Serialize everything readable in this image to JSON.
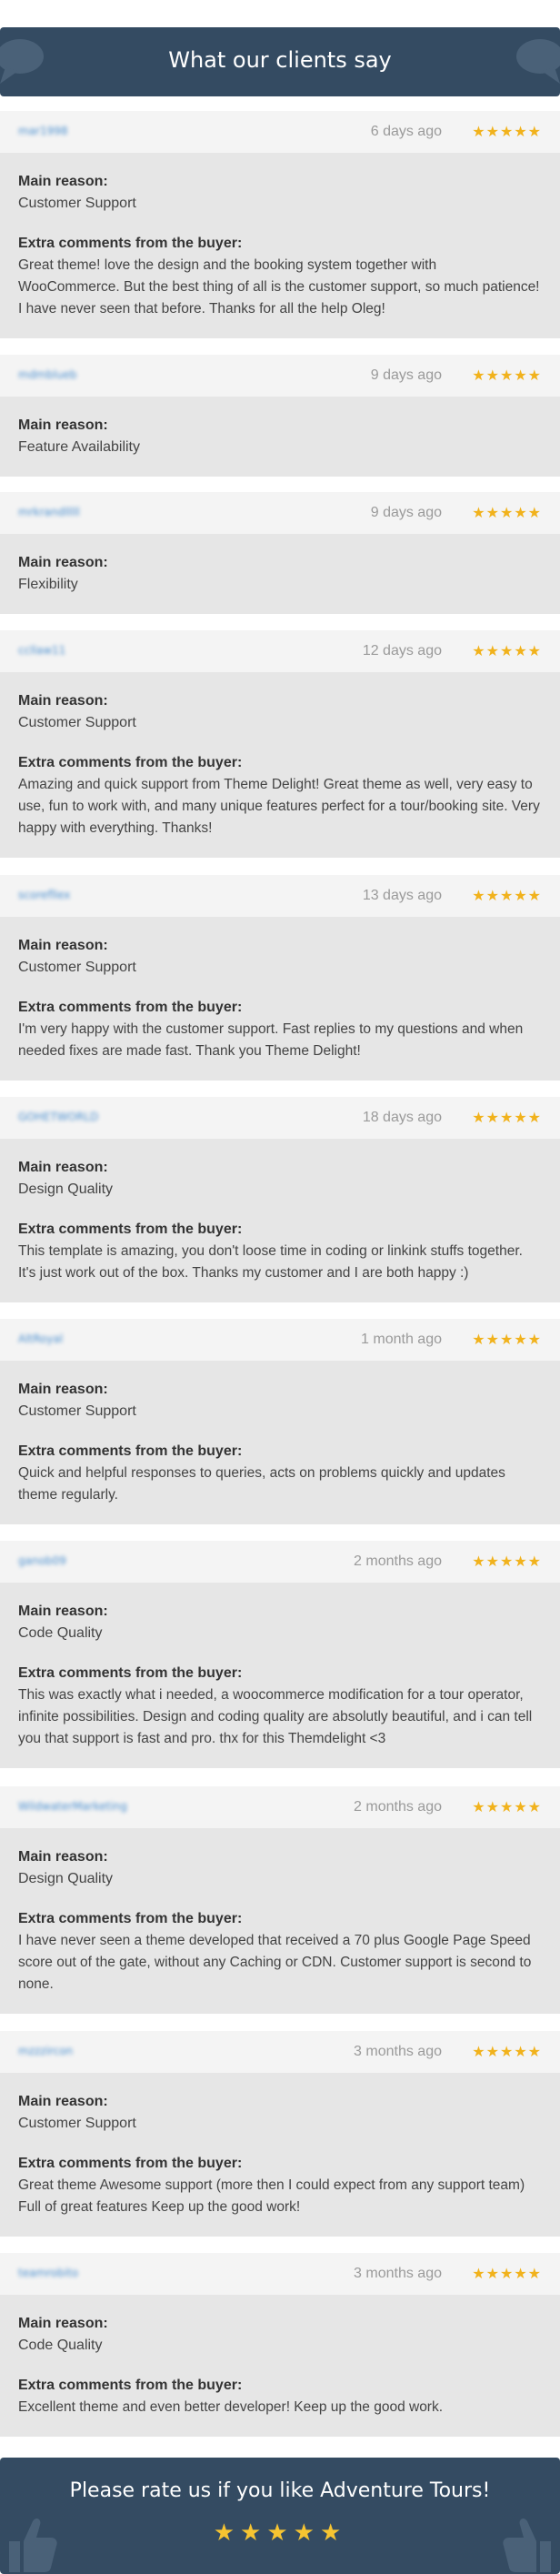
{
  "header": {
    "title": "What our clients say"
  },
  "labels": {
    "main_reason": "Main reason:",
    "extra_comments": "Extra comments from the buyer:"
  },
  "star_glyph": "★★★★★",
  "reviews": [
    {
      "username": "mar1998",
      "date": "6 days ago",
      "rating": 5,
      "main_reason": "Customer Support",
      "comment": "Great theme! love the design and the booking system together with WooCommerce. But the best thing of all is the customer support, so much patience! I have never seen that before. Thanks for all the help Oleg!"
    },
    {
      "username": "mdmblueb",
      "date": "9 days ago",
      "rating": 5,
      "main_reason": "Feature Availability",
      "comment": ""
    },
    {
      "username": "mrkrandlllll",
      "date": "9 days ago",
      "rating": 5,
      "main_reason": "Flexibility",
      "comment": ""
    },
    {
      "username": "ccllaw11",
      "date": "12 days ago",
      "rating": 5,
      "main_reason": "Customer Support",
      "comment": "Amazing and quick support from Theme Delight! Great theme as well, very easy to use, fun to work with, and many unique features perfect for a tour/booking site. Very happy with everything. Thanks!"
    },
    {
      "username": "scorefllex",
      "date": "13 days ago",
      "rating": 5,
      "main_reason": "Customer Support",
      "comment": "I'm very happy with the customer support. Fast replies to my questions and when needed fixes are made fast. Thank you Theme Delight!"
    },
    {
      "username": "GOHETWORLD",
      "date": "18 days ago",
      "rating": 5,
      "main_reason": "Design Quality",
      "comment": "This template is amazing, you don't loose time in coding or linkink stuffs together. It's just work out of the box. Thanks my customer and I are both happy :)"
    },
    {
      "username": "AltRoyal",
      "date": "1 month ago",
      "rating": 5,
      "main_reason": "Customer Support",
      "comment": "Quick and helpful responses to queries, acts on problems quickly and updates theme regularly."
    },
    {
      "username": "ganob09",
      "date": "2 months ago",
      "rating": 5,
      "main_reason": "Code Quality",
      "comment": "This was exactly what i needed, a woocommerce modification for a tour operator, infinite possibilities. Design and coding quality are absolutly beautiful, and i can tell you that support is fast and pro. thx for this Themdelight <3"
    },
    {
      "username": "WildwaterMarketing",
      "date": "2 months ago",
      "rating": 5,
      "main_reason": "Design Quality",
      "comment": "I have never seen a theme developed that received a 70 plus Google Page Speed score out of the gate, without any Caching or CDN. Customer support is second to none."
    },
    {
      "username": "mzzzircon",
      "date": "3 months ago",
      "rating": 5,
      "main_reason": "Customer Support",
      "comment": "Great theme Awesome support (more then I could expect from any support team) Full of great features Keep up the good work!"
    },
    {
      "username": "teamrobito",
      "date": "3 months ago",
      "rating": 5,
      "main_reason": "Code Quality",
      "comment": "Excellent theme and even better developer! Keep up the good work."
    }
  ],
  "footer": {
    "title": "Please rate us if you like Adventure Tours!",
    "stars": "★★★★★"
  },
  "colors": {
    "banner": "#344b62",
    "star": "#f1b21c",
    "username": "#4b8fcf"
  }
}
